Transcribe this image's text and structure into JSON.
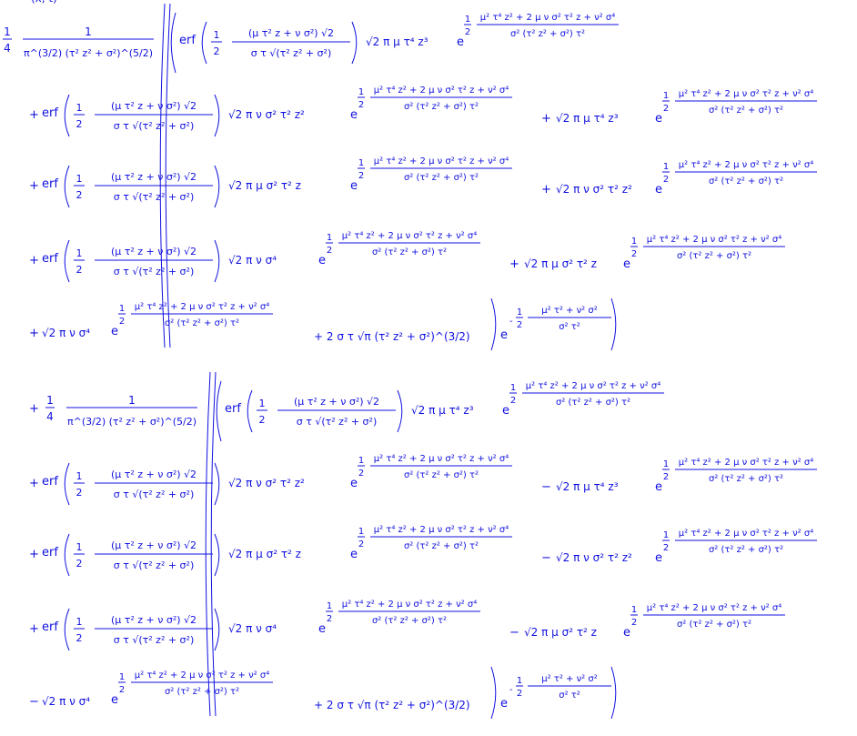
{
  "document": {
    "color": "#1010e0",
    "background": "#ffffff",
    "top_fragment": "(x, t)",
    "common": {
      "erf": "erf",
      "one": "1",
      "two": "2",
      "four": "4",
      "plus": "+",
      "minus": "−",
      "erf_num": "(μ τ² z + ν σ²) √2",
      "erf_den": "σ τ √(τ² z² + σ²)",
      "exp_num": "μ² τ⁴ z² + 2 μ ν σ² τ² z + ν² σ⁴",
      "exp_den": "σ² (τ² z² + σ²) τ²",
      "e": "e",
      "pref_den": "π^(3/2) (τ² z² + σ²)^(5/2)",
      "final_exp_num": "μ² τ² + ν² σ²",
      "final_exp_den": "σ² τ²",
      "tail": "+ 2 σ τ √π (τ² z² + σ²)^(3/2)"
    },
    "terms": {
      "t1": "√2 π μ τ⁴ z³",
      "t2": "√2 π ν σ² τ² z²",
      "t3": "√2 π μ σ² τ² z",
      "t4": "√2 π ν σ⁴"
    }
  }
}
